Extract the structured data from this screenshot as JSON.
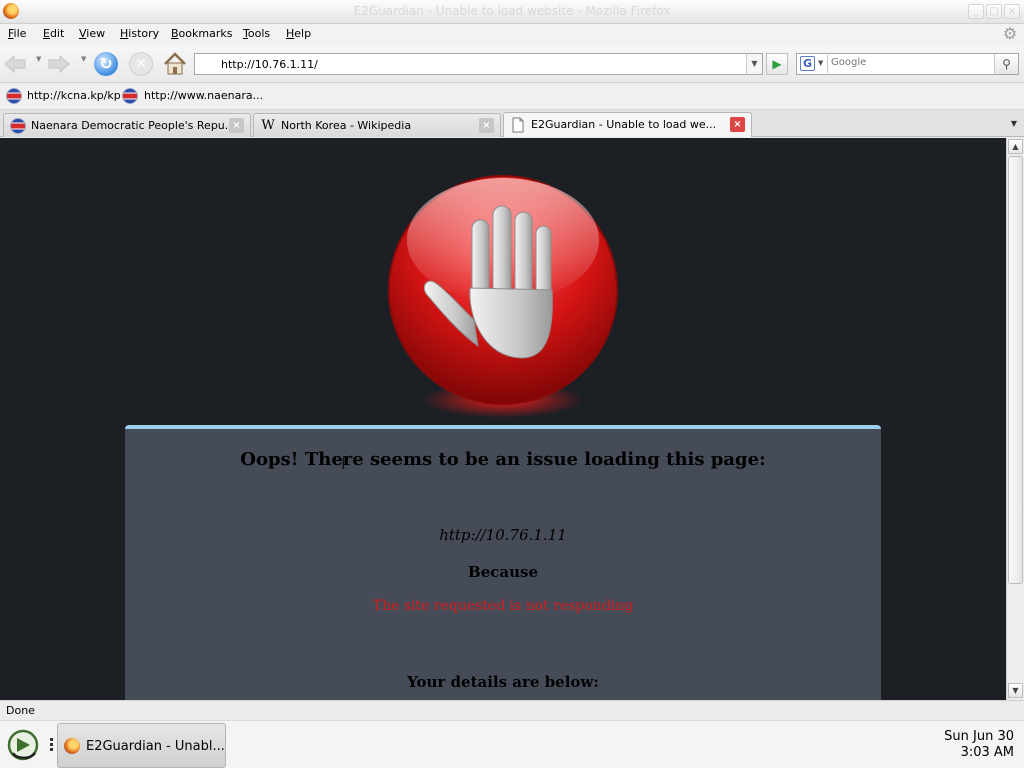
{
  "window": {
    "title": "E2Guardian - Unable to load website - Mozilla Firefox",
    "app_icon": "firefox-icon",
    "controls": {
      "minimize": "_",
      "maximize": "□",
      "close": "×"
    }
  },
  "menu": {
    "items": [
      {
        "label": "File",
        "accesskey": "F",
        "rest": "ile"
      },
      {
        "label": "Edit",
        "accesskey": "E",
        "rest": "dit"
      },
      {
        "label": "View",
        "accesskey": "V",
        "rest": "iew"
      },
      {
        "label": "History",
        "accesskey": "H",
        "rest": "istory"
      },
      {
        "label": "Bookmarks",
        "accesskey": "B",
        "rest": "ookmarks"
      },
      {
        "label": "Tools",
        "accesskey": "T",
        "rest": "ools"
      },
      {
        "label": "Help",
        "accesskey": "H",
        "rest": "elp"
      }
    ],
    "throbber_icon": "gear-throbber-icon"
  },
  "navigation": {
    "back_icon": "back-arrow-icon",
    "forward_icon": "forward-arrow-icon",
    "reload_glyph": "↻",
    "stop_glyph": "✕",
    "home_icon": "home-icon",
    "url": "http://10.76.1.11/",
    "url_dropdown_glyph": "▼",
    "go_glyph": "▶",
    "search": {
      "engine": "Google",
      "engine_glyph": "G",
      "placeholder": "Google",
      "go_icon": "magnifier-icon",
      "go_glyph": "🔍"
    }
  },
  "bookmarks": [
    {
      "label": "http://kcna.kp/kp",
      "icon": "kp-flag-icon"
    },
    {
      "label": "http://www.naenara...",
      "icon": "kp-flag-icon"
    }
  ],
  "tabs": [
    {
      "label": "Naenara Democratic People's Repu...",
      "icon": "kp-flag-icon",
      "active": false
    },
    {
      "label": "North Korea - Wikipedia",
      "icon": "wikipedia-icon",
      "active": false
    },
    {
      "label": "E2Guardian - Unable to load we...",
      "icon": "page-icon",
      "active": true
    }
  ],
  "tab_list_glyph": "▼",
  "page": {
    "heading": "Oops! There seems to be an issue loading this page:",
    "url": "http://10.76.1.11",
    "because_label": "Because",
    "reason": "The site requested is not responding",
    "details_label": "Your details are below:",
    "accent_color": "#9ccfee",
    "reason_color": "#d81c1c",
    "background_color": "#1c1f24",
    "panel_color": "#464b58"
  },
  "status": {
    "text": "Done"
  },
  "taskbar": {
    "start_icon": "start-menu-icon",
    "task_label": "E2Guardian - Unabl...",
    "clock_date": "Sun Jun 30",
    "clock_time": "3:03 AM"
  }
}
